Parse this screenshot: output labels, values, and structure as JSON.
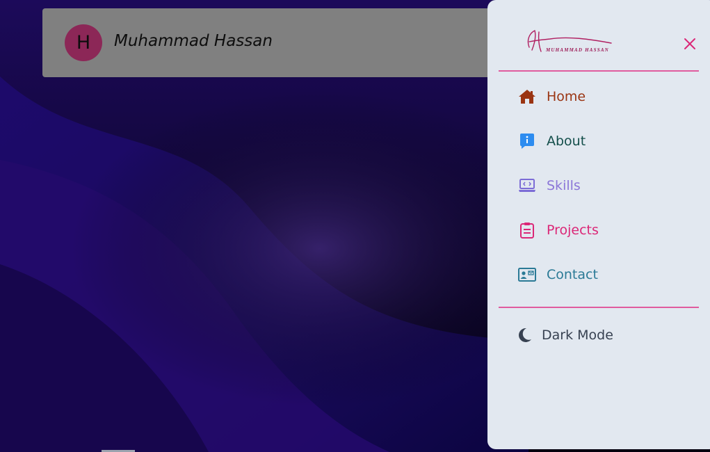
{
  "header": {
    "avatar_letter": "H",
    "site_name": "Muhammad Hassan"
  },
  "drawer": {
    "logo_text": "MUHAMMAD HASSAN",
    "logo_initial": "H",
    "close_icon": "close-icon",
    "nav": [
      {
        "label": "Home",
        "icon": "home-icon",
        "color": "#9a3412"
      },
      {
        "label": "About",
        "icon": "info-message-icon",
        "color": "#134e4a"
      },
      {
        "label": "Skills",
        "icon": "laptop-code-icon",
        "color": "#8b76d8"
      },
      {
        "label": "Projects",
        "icon": "clipboard-icon",
        "color": "#db2777"
      },
      {
        "label": "Contact",
        "icon": "contact-card-icon",
        "color": "#2b7a96"
      }
    ],
    "dark_mode": {
      "label": "Dark Mode",
      "icon": "moon-icon"
    }
  },
  "colors": {
    "accent": "#e05b9e",
    "drawer_bg": "#e2e8f0",
    "header_bg": "#808080",
    "avatar_bg": "#8c2757"
  }
}
